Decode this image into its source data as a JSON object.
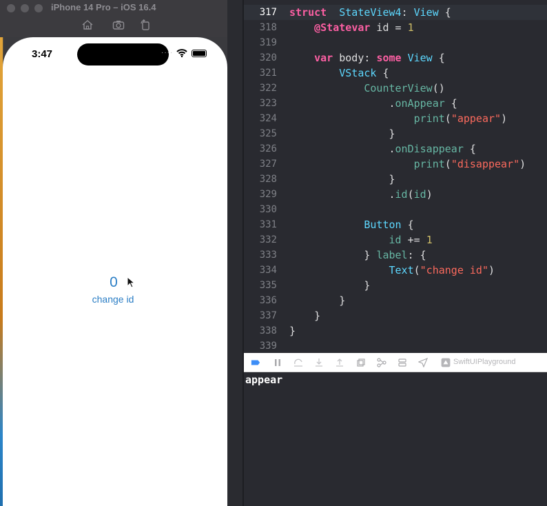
{
  "simulator": {
    "title": "iPhone 14 Pro – iOS 16.4",
    "toolbar_icons": [
      "home-icon",
      "screenshot-icon",
      "rotate-icon"
    ],
    "status_bar": {
      "time": "3:47",
      "signal": "····",
      "wifi_icon": "wifi-icon",
      "battery_icon": "battery-icon"
    },
    "app": {
      "counter_value": "0",
      "button_label": "change id"
    }
  },
  "editor": {
    "current_line": 317,
    "lines": [
      {
        "n": "317",
        "tokens": [
          [
            "kw",
            "struct"
          ],
          [
            "",
            "  "
          ],
          [
            "ty",
            "StateView4"
          ],
          [
            "",
            ": "
          ],
          [
            "ty",
            "View"
          ],
          [
            "",
            " {"
          ]
        ]
      },
      {
        "n": "318",
        "tokens": [
          [
            "",
            "    "
          ],
          [
            "kw",
            "@State"
          ],
          [
            "",
            "",
            " "
          ],
          [
            "kw",
            "var"
          ],
          [
            "",
            " id = "
          ],
          [
            "nm",
            "1"
          ]
        ]
      },
      {
        "n": "319",
        "tokens": []
      },
      {
        "n": "320",
        "tokens": [
          [
            "",
            "    "
          ],
          [
            "kw",
            "var"
          ],
          [
            "",
            " body: "
          ],
          [
            "kw",
            "some"
          ],
          [
            "",
            " "
          ],
          [
            "ty",
            "View"
          ],
          [
            "",
            " {"
          ]
        ]
      },
      {
        "n": "321",
        "tokens": [
          [
            "",
            "        "
          ],
          [
            "ty",
            "VStack"
          ],
          [
            "",
            " {"
          ]
        ]
      },
      {
        "n": "322",
        "tokens": [
          [
            "",
            "            "
          ],
          [
            "fn",
            "CounterView"
          ],
          [
            "",
            "()"
          ]
        ]
      },
      {
        "n": "323",
        "tokens": [
          [
            "",
            "                ."
          ],
          [
            "mem",
            "onAppear"
          ],
          [
            "",
            " {"
          ]
        ]
      },
      {
        "n": "324",
        "tokens": [
          [
            "",
            "                    "
          ],
          [
            "fn",
            "print"
          ],
          [
            "",
            "("
          ],
          [
            "st",
            "\"appear\""
          ],
          [
            "",
            ")"
          ]
        ]
      },
      {
        "n": "325",
        "tokens": [
          [
            "",
            "                }"
          ]
        ]
      },
      {
        "n": "326",
        "tokens": [
          [
            "",
            "                ."
          ],
          [
            "mem",
            "onDisappear"
          ],
          [
            "",
            " {"
          ]
        ]
      },
      {
        "n": "327",
        "tokens": [
          [
            "",
            "                    "
          ],
          [
            "fn",
            "print"
          ],
          [
            "",
            "("
          ],
          [
            "st",
            "\"disappear\""
          ],
          [
            "",
            ")"
          ]
        ]
      },
      {
        "n": "328",
        "tokens": [
          [
            "",
            "                }"
          ]
        ]
      },
      {
        "n": "329",
        "tokens": [
          [
            "",
            "                ."
          ],
          [
            "mem",
            "id"
          ],
          [
            "",
            "("
          ],
          [
            "mem",
            "id"
          ],
          [
            "",
            ")"
          ]
        ]
      },
      {
        "n": "330",
        "tokens": []
      },
      {
        "n": "331",
        "tokens": [
          [
            "",
            "            "
          ],
          [
            "ty",
            "Button"
          ],
          [
            "",
            " {"
          ]
        ]
      },
      {
        "n": "332",
        "tokens": [
          [
            "",
            "                "
          ],
          [
            "mem",
            "id"
          ],
          [
            "",
            " += "
          ],
          [
            "nm",
            "1"
          ]
        ]
      },
      {
        "n": "333",
        "tokens": [
          [
            "",
            "            } "
          ],
          [
            "mem",
            "label"
          ],
          [
            "",
            ": {"
          ]
        ]
      },
      {
        "n": "334",
        "tokens": [
          [
            "",
            "                "
          ],
          [
            "ty",
            "Text"
          ],
          [
            "",
            "("
          ],
          [
            "st",
            "\"change id\""
          ],
          [
            "",
            ")"
          ]
        ]
      },
      {
        "n": "335",
        "tokens": [
          [
            "",
            "            }"
          ]
        ]
      },
      {
        "n": "336",
        "tokens": [
          [
            "",
            "        }"
          ]
        ]
      },
      {
        "n": "337",
        "tokens": [
          [
            "",
            "    }"
          ]
        ]
      },
      {
        "n": "338",
        "tokens": [
          [
            "",
            "}"
          ]
        ]
      },
      {
        "n": "339",
        "tokens": []
      }
    ]
  },
  "debug_bar": {
    "icons": [
      "breakpoint-toggle-icon",
      "pause-icon",
      "step-over-icon",
      "step-into-icon",
      "step-out-icon",
      "debug-view-hierarchy-icon",
      "memory-graph-icon",
      "environment-icon",
      "location-icon"
    ],
    "target_label": "SwiftUIPlayground"
  },
  "console": {
    "output": "appear"
  }
}
